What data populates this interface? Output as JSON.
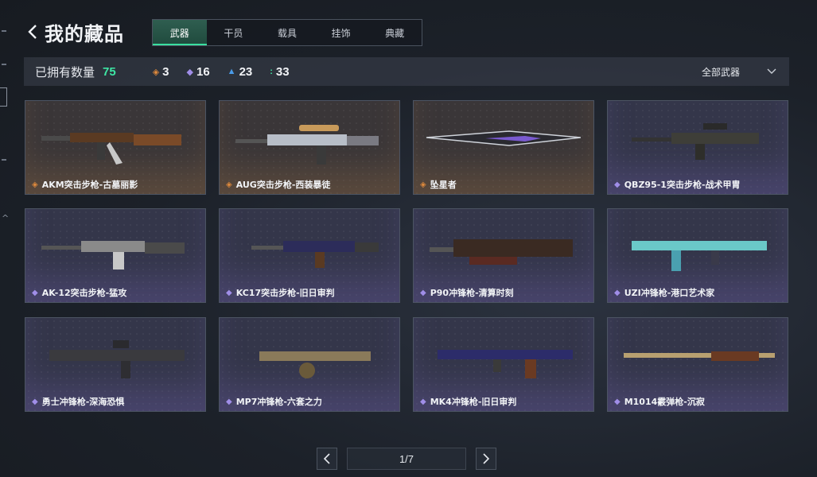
{
  "header": {
    "title": "我的藏品"
  },
  "tabs": [
    {
      "label": "武器",
      "active": true
    },
    {
      "label": "干员",
      "active": false
    },
    {
      "label": "载具",
      "active": false
    },
    {
      "label": "挂饰",
      "active": false
    },
    {
      "label": "典藏",
      "active": false
    }
  ],
  "stats": {
    "owned_label": "已拥有数量",
    "owned_count": "75",
    "gold_count": "3",
    "purple_count": "16",
    "blue_count": "23",
    "green_count": "33"
  },
  "filter": {
    "label": "全部武器"
  },
  "colors": {
    "accent": "#3ee6a4",
    "gold": "#e08a3c",
    "purple": "#a08ee8",
    "blue": "#4a9be8"
  },
  "items": [
    {
      "name": "AKM突击步枪-古墓丽影",
      "rarity": "gold"
    },
    {
      "name": "AUG突击步枪-西装暴徒",
      "rarity": "gold"
    },
    {
      "name": "坠星者",
      "rarity": "gold"
    },
    {
      "name": "QBZ95-1突击步枪-战术甲胄",
      "rarity": "purple"
    },
    {
      "name": "AK-12突击步枪-猛攻",
      "rarity": "purple"
    },
    {
      "name": "KC17突击步枪-旧日审判",
      "rarity": "purple"
    },
    {
      "name": "P90冲锋枪-清算时刻",
      "rarity": "purple"
    },
    {
      "name": "UZI冲锋枪-港口艺术家",
      "rarity": "purple"
    },
    {
      "name": "勇士冲锋枪-深海恐惧",
      "rarity": "purple"
    },
    {
      "name": "MP7冲锋枪-六套之力",
      "rarity": "purple"
    },
    {
      "name": "MK4冲锋枪-旧日审判",
      "rarity": "purple"
    },
    {
      "name": "M1014霰弹枪-沉寂",
      "rarity": "purple"
    }
  ],
  "pagination": {
    "label": "1/7"
  }
}
